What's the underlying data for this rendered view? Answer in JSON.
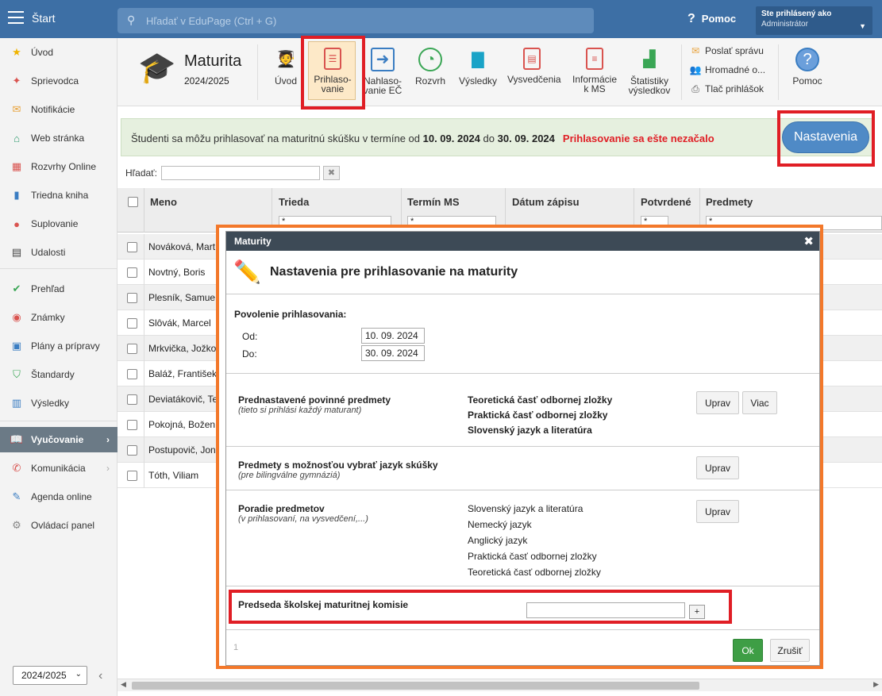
{
  "topbar": {
    "start_label": "Štart",
    "search_placeholder": "Hľadať v EduPage (Ctrl + G)",
    "help_label": "Pomoc",
    "user_line1": "Ste prihlásený ako",
    "user_line2": "Administrátor"
  },
  "sidebar": {
    "items": [
      {
        "label": "Úvod",
        "icon": "star-icon"
      },
      {
        "label": "Sprievodca",
        "icon": "wand-icon"
      },
      {
        "label": "Notifikácie",
        "icon": "mail-icon"
      },
      {
        "label": "Web stránka",
        "icon": "home-icon"
      },
      {
        "label": "Rozvrhy Online",
        "icon": "grid-icon"
      },
      {
        "label": "Triedna kniha",
        "icon": "book-icon"
      },
      {
        "label": "Suplovanie",
        "icon": "person-icon"
      },
      {
        "label": "Udalosti",
        "icon": "calendar-icon"
      },
      {
        "label": "Prehľad",
        "icon": "check-icon"
      },
      {
        "label": "Známky",
        "icon": "grade-icon"
      },
      {
        "label": "Plány a prípravy",
        "icon": "briefcase-icon"
      },
      {
        "label": "Štandardy",
        "icon": "shield-icon"
      },
      {
        "label": "Výsledky",
        "icon": "bar-icon"
      },
      {
        "label": "Vyučovanie",
        "icon": "open-book-icon"
      },
      {
        "label": "Komunikácia",
        "icon": "chat-icon"
      },
      {
        "label": "Agenda online",
        "icon": "pen-icon"
      },
      {
        "label": "Ovládací panel",
        "icon": "gear-icon"
      }
    ],
    "year": "2024/2025"
  },
  "toolbar": {
    "title": "Maturita",
    "subtitle": "2024/2025",
    "buttons": [
      {
        "label": "Úvod"
      },
      {
        "label": "Prihlaso-\nvanie"
      },
      {
        "label": "Nahlaso-\nvanie EČ"
      },
      {
        "label": "Rozvrh"
      },
      {
        "label": "Výsledky"
      },
      {
        "label": "Vysvedčenia"
      },
      {
        "label": "Informácie\nk MS"
      },
      {
        "label": "Štatistiky\nvýsledkov"
      },
      {
        "label": "Pomoc"
      }
    ],
    "small": [
      "Poslať správu",
      "Hromadné o...",
      "Tlač prihlášok"
    ]
  },
  "banner": {
    "text_pre": "Študenti sa môžu prihlasovať na maturitnú skúšku v termíne od ",
    "date_from": "10. 09. 2024",
    "text_mid": " do ",
    "date_to": "30. 09. 2024",
    "warning": "Prihlasovanie sa ešte nezačalo",
    "settings_button": "Nastavenia"
  },
  "filter": {
    "label": "Hľadať:"
  },
  "table": {
    "headers": [
      "Meno",
      "Trieda",
      "Termín MS",
      "Dátum zápisu",
      "Potvrdené",
      "Predmety"
    ],
    "filter_value": "*",
    "rows": [
      "Nováková, Mart",
      "Novtný, Boris",
      "Plesník, Samue",
      "Slôvák, Marcel",
      "Mrkvička, Jožko",
      "Baláž, František",
      "Deviatákovič, Te",
      "Pokojná, Božen",
      "Postupovič, Jon",
      "Tóth, Viliam"
    ]
  },
  "modal": {
    "header": "Maturity",
    "title": "Nastavenia pre prihlasovanie na maturity",
    "perm_label": "Povolenie prihlasovania:",
    "od_label": "Od:",
    "od_value": "10. 09. 2024",
    "do_label": "Do:",
    "do_value": "30. 09. 2024",
    "preset_title": "Prednastavené povinné predmety",
    "preset_sub": "(tieto si prihlási každý maturant)",
    "preset_subjects": [
      "Teoretická časť odbornej zložky",
      "Praktická časť odbornej zložky",
      "Slovenský jazyk a literatúra"
    ],
    "edit_label": "Uprav",
    "more_label": "Viac",
    "lang_title": "Predmety s možnosťou vybrať jazyk skúšky",
    "lang_sub": "(pre bilingválne gymnáziá)",
    "order_title": "Poradie predmetov",
    "order_sub": "(v prihlasovaní, na vysvedčení,...)",
    "order_subjects": [
      "Slovenský jazyk a literatúra",
      "Nemecký jazyk",
      "Anglický jazyk",
      "Praktická časť odbornej zložky",
      "Teoretická časť odbornej zložky"
    ],
    "chair_label": "Predseda školskej maturitnej komisie",
    "plus": "+",
    "page": "1",
    "ok": "Ok",
    "cancel": "Zrušiť"
  }
}
